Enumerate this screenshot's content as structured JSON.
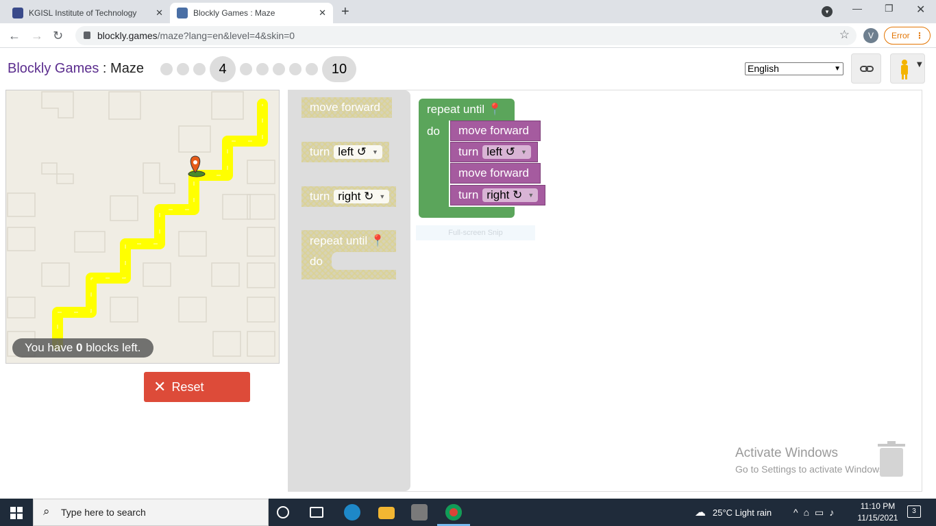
{
  "browser": {
    "tabs": [
      {
        "label": "KGISL Institute of Technology",
        "active": false
      },
      {
        "label": "Blockly Games : Maze",
        "active": true
      }
    ],
    "url_host": "blockly.games",
    "url_path": "/maze?lang=en&level=4&skin=0",
    "profile_initial": "V",
    "error_chip": "Error"
  },
  "header": {
    "brand": "Blockly Games",
    "separator": " : ",
    "game": "Maze",
    "current_level": "4",
    "max_level": "10",
    "language": "English"
  },
  "maze": {
    "blocks_left_prefix": "You have ",
    "blocks_left_count": "0",
    "blocks_left_suffix": " blocks left."
  },
  "reset_label": "Reset",
  "toolbox": {
    "move_forward": "move forward",
    "turn": "turn",
    "left": "left ↺",
    "right": "right ↻",
    "repeat_until": "repeat until",
    "do": "do"
  },
  "program": {
    "repeat_until": "repeat until",
    "do": "do",
    "stmt1": "move forward",
    "stmt2_turn": "turn",
    "stmt2_dir": "left ↺",
    "stmt3": "move forward",
    "stmt4_turn": "turn",
    "stmt4_dir": "right ↻"
  },
  "snip_label": "Full-screen Snip",
  "watermark": {
    "title": "Activate Windows",
    "subtitle": "Go to Settings to activate Windows."
  },
  "taskbar": {
    "search_placeholder": "Type here to search",
    "weather": "25°C  Light rain",
    "time": "11:10 PM",
    "date": "11/15/2021",
    "notification_count": "3"
  },
  "colors": {
    "brand": "#5b2d8e",
    "loop_green": "#5ba55b",
    "action_purple": "#a55b9f",
    "reset_red": "#dd4b39",
    "path_yellow": "#ffff00"
  }
}
